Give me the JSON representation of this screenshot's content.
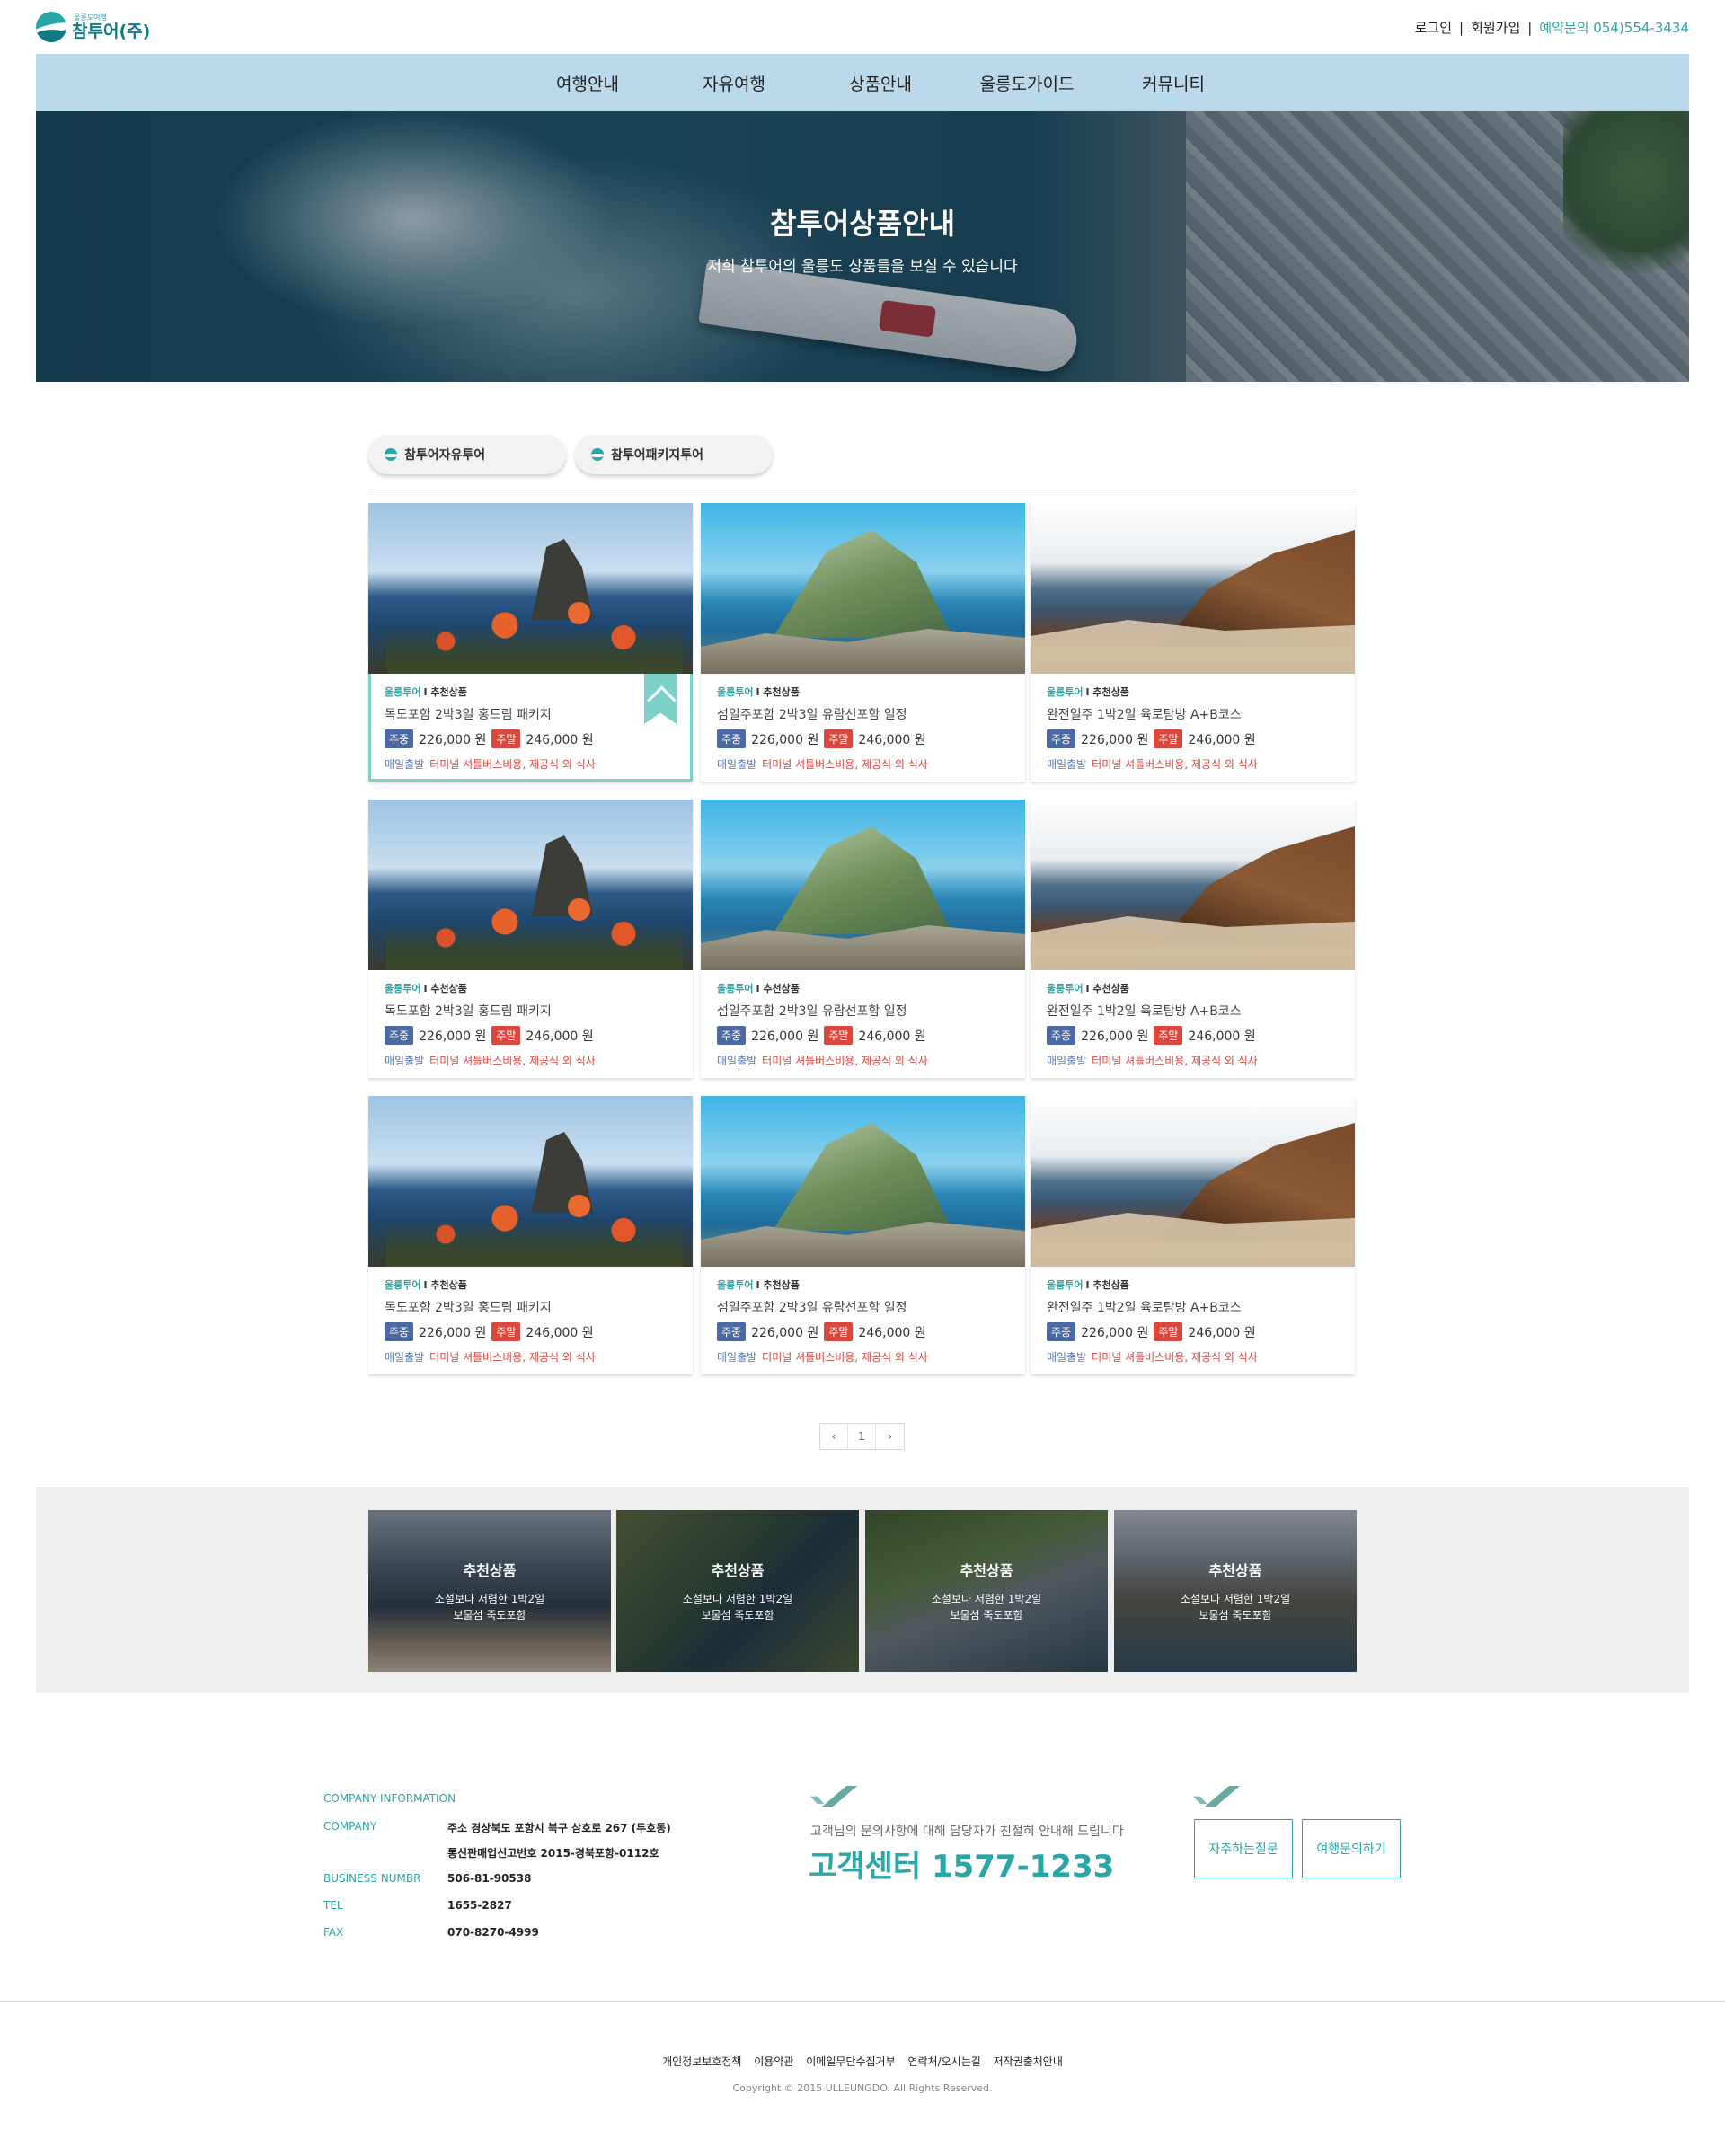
{
  "header": {
    "logo_sub": "울릉도여행",
    "logo_main": "참투어(주)",
    "login": "로그인",
    "signup": "회원가입",
    "reservation": "예약문의 054)554-3434"
  },
  "nav": [
    "여행안내",
    "자유여행",
    "상품안내",
    "울릉도가이드",
    "커뮤니티"
  ],
  "hero": {
    "title": "참투어상품안내",
    "desc": "저희 참투어의 울릉도 상품들을 보실 수 있습니다"
  },
  "tabs": [
    "참투어자유투어",
    "참투어패키지투어"
  ],
  "products": [
    {
      "cat": "울릉투어",
      "rec": "I 추천상품",
      "title": "독도포함 2박3일 홍드림 패키지",
      "weekday_label": "주중",
      "weekday_price": "226,000 원",
      "weekend_label": "주말",
      "weekend_price": "246,000 원",
      "depart": "매일출발",
      "includes": "터미널 셔틀버스비용, 제공식 외 식사"
    },
    {
      "cat": "울릉투어",
      "rec": "I 추천상품",
      "title": "섬일주포함 2박3일 유람선포함 일정",
      "weekday_label": "주중",
      "weekday_price": "226,000 원",
      "weekend_label": "주말",
      "weekend_price": "246,000 원",
      "depart": "매일출발",
      "includes": "터미널 셔틀버스비용, 제공식 외 식사"
    },
    {
      "cat": "울릉투어",
      "rec": "I 추천상품",
      "title": "완전일주 1박2일 육로탐방 A+B코스",
      "weekday_label": "주중",
      "weekday_price": "226,000 원",
      "weekend_label": "주말",
      "weekend_price": "246,000 원",
      "depart": "매일출발",
      "includes": "터미널 셔틀버스비용, 제공식 외 식사"
    },
    {
      "cat": "울릉투어",
      "rec": "I 추천상품",
      "title": "독도포함 2박3일 홍드림 패키지",
      "weekday_label": "주중",
      "weekday_price": "226,000 원",
      "weekend_label": "주말",
      "weekend_price": "246,000 원",
      "depart": "매일출발",
      "includes": "터미널 셔틀버스비용, 제공식 외 식사"
    },
    {
      "cat": "울릉투어",
      "rec": "I 추천상품",
      "title": "섬일주포함 2박3일 유람선포함 일정",
      "weekday_label": "주중",
      "weekday_price": "226,000 원",
      "weekend_label": "주말",
      "weekend_price": "246,000 원",
      "depart": "매일출발",
      "includes": "터미널 셔틀버스비용, 제공식 외 식사"
    },
    {
      "cat": "울릉투어",
      "rec": "I 추천상품",
      "title": "완전일주 1박2일 육로탐방 A+B코스",
      "weekday_label": "주중",
      "weekday_price": "226,000 원",
      "weekend_label": "주말",
      "weekend_price": "246,000 원",
      "depart": "매일출발",
      "includes": "터미널 셔틀버스비용, 제공식 외 식사"
    },
    {
      "cat": "울릉투어",
      "rec": "I 추천상품",
      "title": "독도포함 2박3일 홍드림 패키지",
      "weekday_label": "주중",
      "weekday_price": "226,000 원",
      "weekend_label": "주말",
      "weekend_price": "246,000 원",
      "depart": "매일출발",
      "includes": "터미널 셔틀버스비용, 제공식 외 식사"
    },
    {
      "cat": "울릉투어",
      "rec": "I 추천상품",
      "title": "섬일주포함 2박3일 유람선포함 일정",
      "weekday_label": "주중",
      "weekday_price": "226,000 원",
      "weekend_label": "주말",
      "weekend_price": "246,000 원",
      "depart": "매일출발",
      "includes": "터미널 셔틀버스비용, 제공식 외 식사"
    },
    {
      "cat": "울릉투어",
      "rec": "I 추천상품",
      "title": "완전일주 1박2일 육로탐방 A+B코스",
      "weekday_label": "주중",
      "weekday_price": "226,000 원",
      "weekend_label": "주말",
      "weekend_price": "246,000 원",
      "depart": "매일출발",
      "includes": "터미널 셔틀버스비용, 제공식 외 식사"
    }
  ],
  "pager": {
    "prev": "‹",
    "page": "1",
    "next": "›"
  },
  "recommended": [
    {
      "title": "추천상품",
      "line1": "소설보다 저렴한 1박2일",
      "line2": "보물섬 죽도포함"
    },
    {
      "title": "추천상품",
      "line1": "소설보다 저렴한 1박2일",
      "line2": "보물섬 죽도포함"
    },
    {
      "title": "추천상품",
      "line1": "소설보다 저렴한 1박2일",
      "line2": "보물섬 죽도포함"
    },
    {
      "title": "추천상품",
      "line1": "소설보다 저렴한 1박2일",
      "line2": "보물섬 죽도포함"
    }
  ],
  "company": {
    "heading": "COMPANY INFORMATION",
    "company_label": "COMPANY",
    "address": "주소 경상북도 포항시 북구 삼호로 267 (두호동)",
    "permit": "통신판매업신고번호 2015-경북포항-0112호",
    "bn_label": "BUSINESS NUMBR",
    "bn": "506-81-90538",
    "tel_label": "TEL",
    "tel": "1655-2827",
    "fax_label": "FAX",
    "fax": "070-8270-4999"
  },
  "cs": {
    "desc": "고객님의 문의사항에 대해 담당자가 친절히 안내해 드립니다",
    "number": "고객센터 1577-1233",
    "faq": "자주하는질문",
    "inquiry": "여행문의하기"
  },
  "footer": {
    "links": [
      "개인정보보호정책",
      "이용약관",
      "이메일무단수집거부",
      "연락처/오시는길",
      "저작권출처안내"
    ],
    "copyright": "Copyright © 2015 ULLEUNGDO. All Rights Reserved."
  },
  "colors": {
    "accent": "#2aa6a6",
    "nav_bg": "#bcd9ec",
    "weekday_badge": "#4b6aa4",
    "weekend_badge": "#d9473f"
  }
}
